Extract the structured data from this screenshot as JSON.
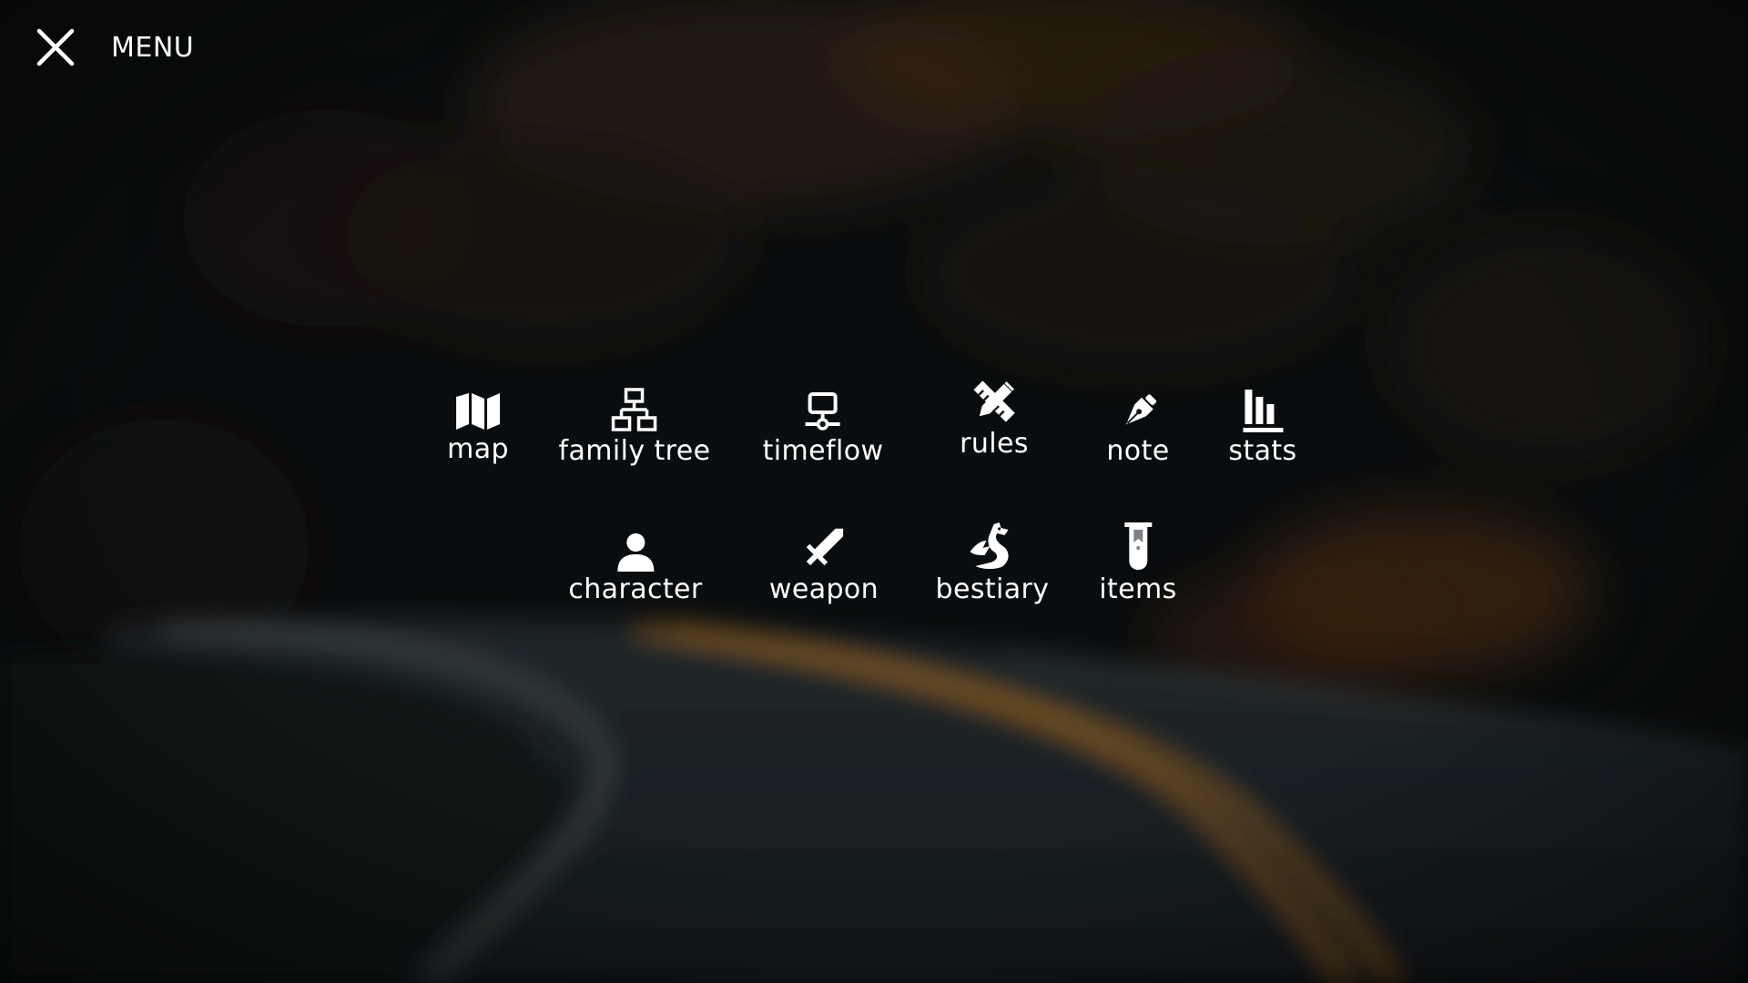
{
  "header": {
    "title": "MENU",
    "close_icon": "close-icon"
  },
  "menu_rows": [
    [
      {
        "key": "map",
        "label": "map",
        "icon": "map-icon"
      },
      {
        "key": "family-tree",
        "label": "family tree",
        "icon": "sitemap-icon"
      },
      {
        "key": "timeflow",
        "label": "timeflow",
        "icon": "timeline-icon"
      },
      {
        "key": "rules",
        "label": "rules",
        "icon": "pencil-ruler-icon"
      },
      {
        "key": "note",
        "label": "note",
        "icon": "pen-nib-icon"
      },
      {
        "key": "stats",
        "label": "stats",
        "icon": "bar-chart-icon"
      }
    ],
    [
      {
        "key": "character",
        "label": "character",
        "icon": "user-icon"
      },
      {
        "key": "weapon",
        "label": "weapon",
        "icon": "sword-icon"
      },
      {
        "key": "bestiary",
        "label": "bestiary",
        "icon": "dragon-icon"
      },
      {
        "key": "items",
        "label": "items",
        "icon": "test-tube-icon"
      }
    ]
  ],
  "colors": {
    "text": "#ffffff",
    "background": "#101518",
    "road_line": "#c98a2a"
  }
}
